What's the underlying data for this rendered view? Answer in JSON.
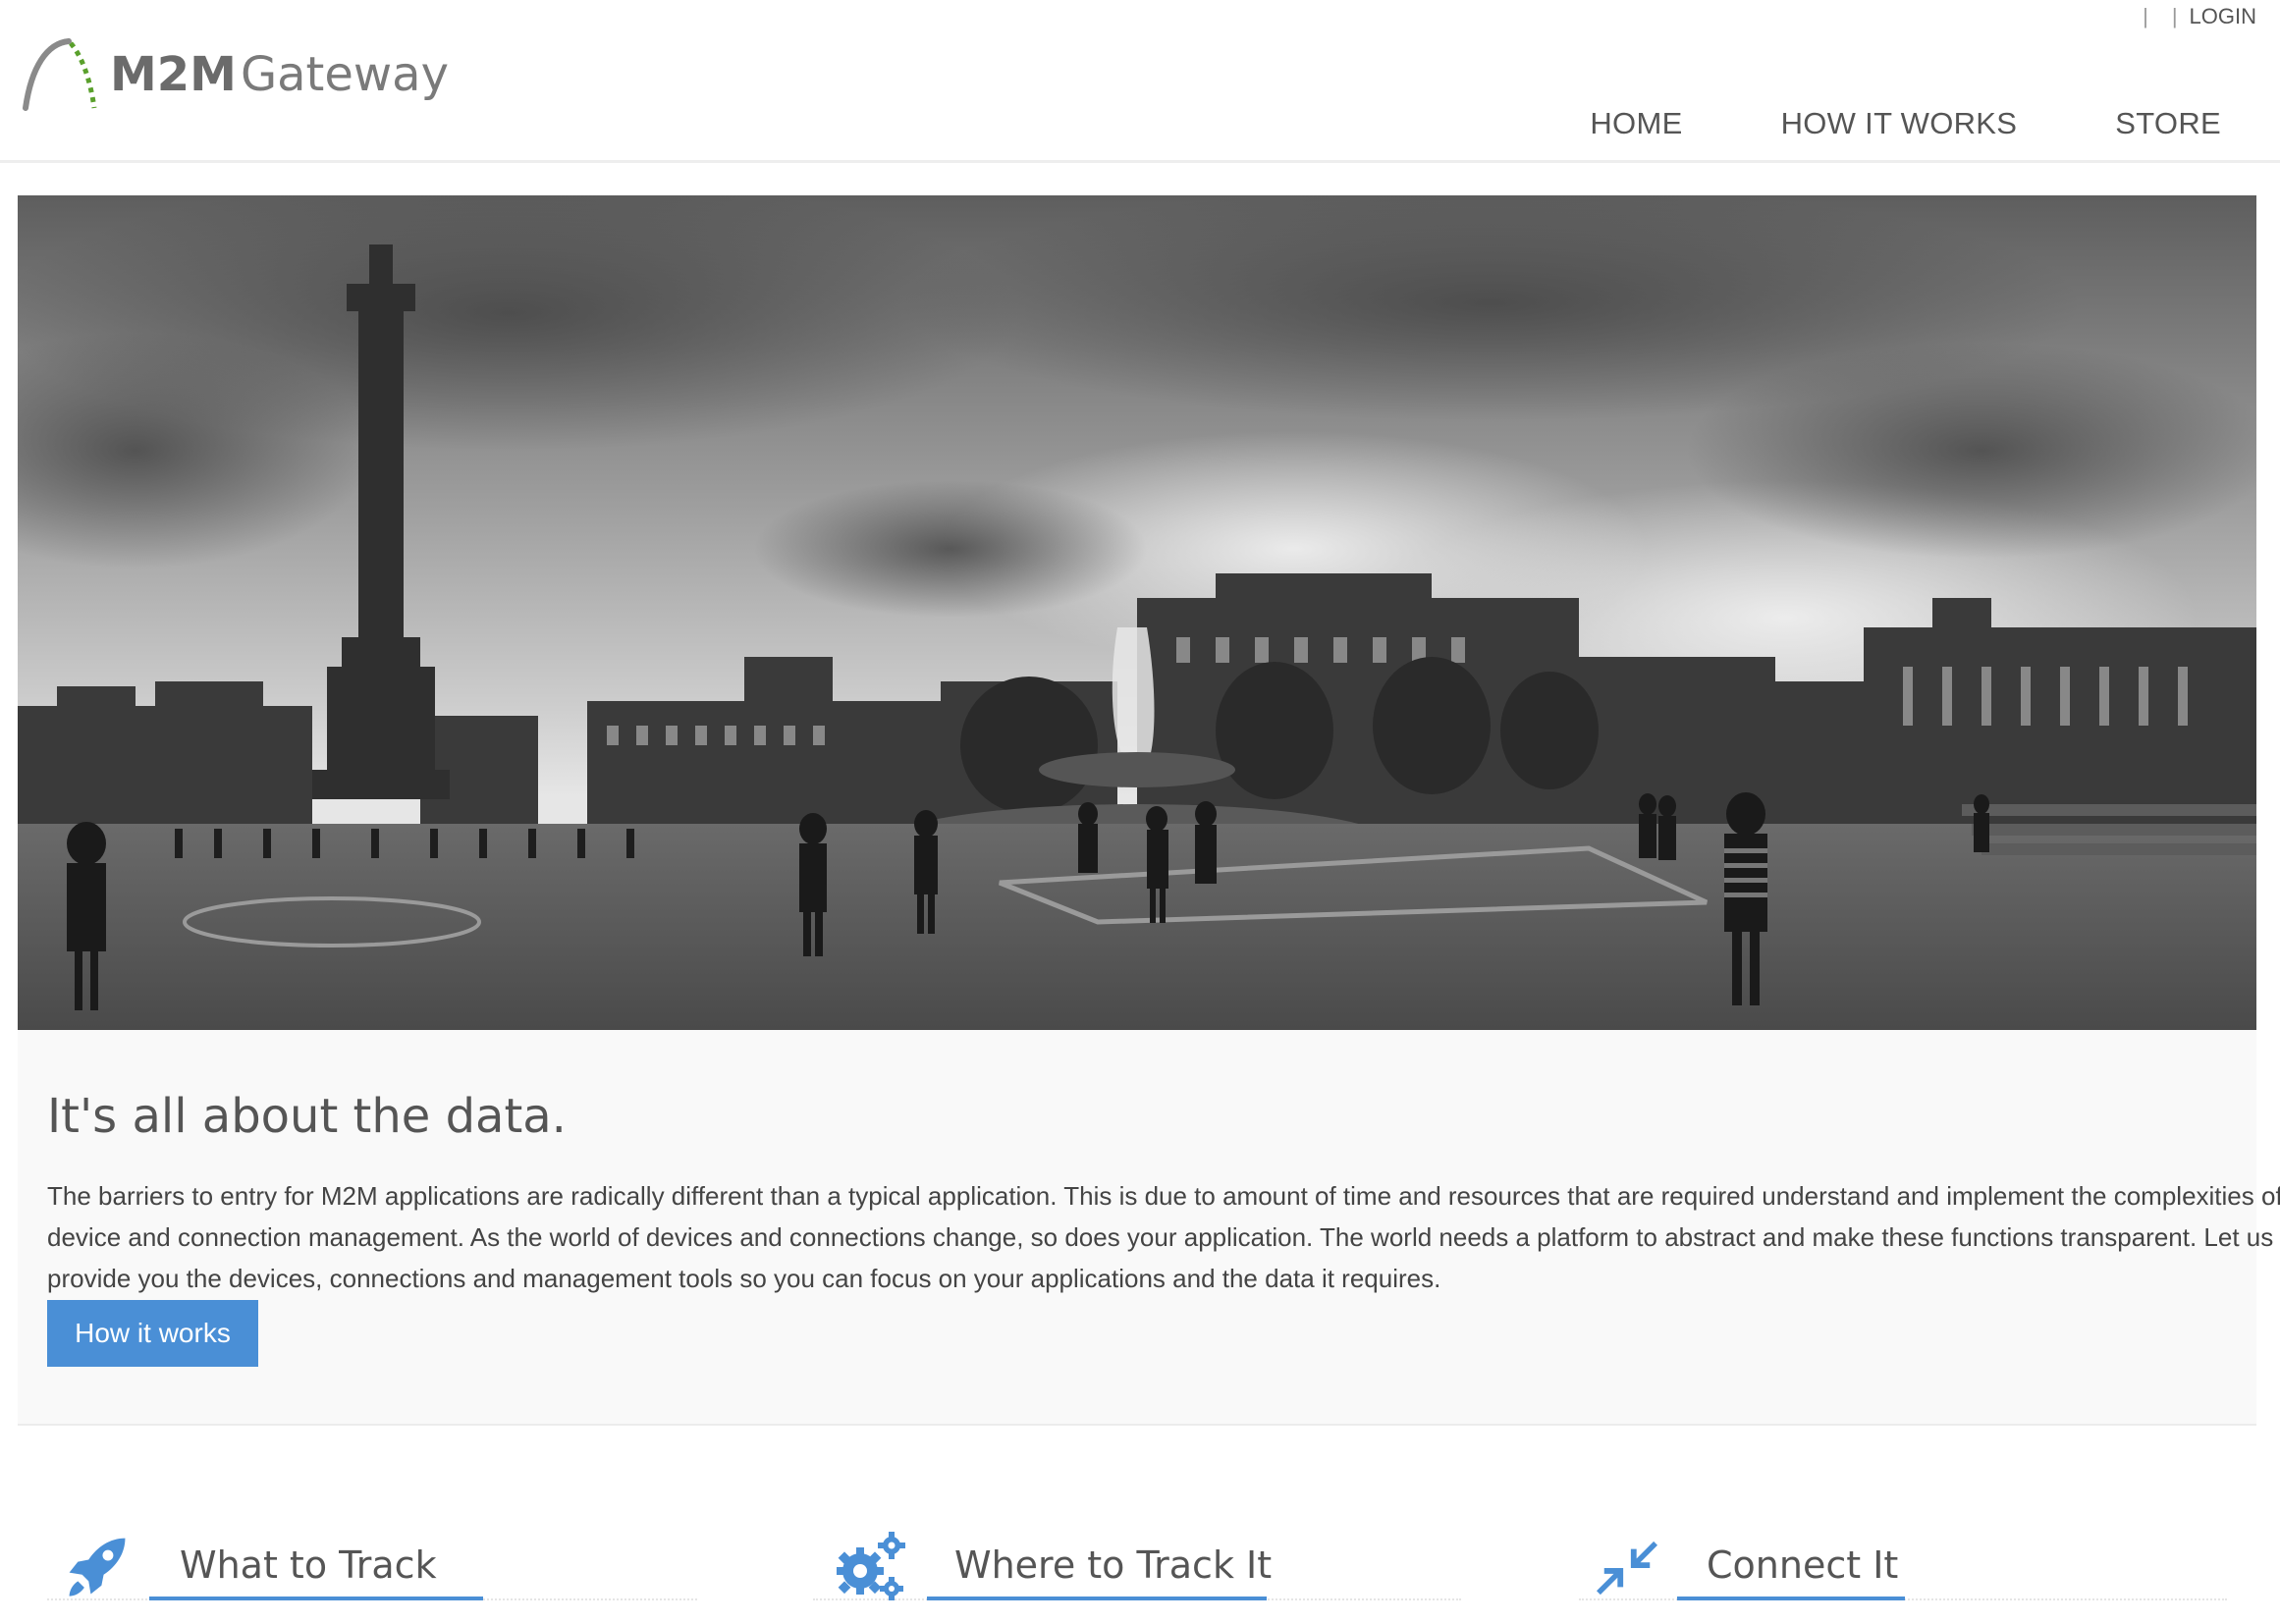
{
  "brand": {
    "m2m": "M2M",
    "gateway": "Gateway"
  },
  "utility": {
    "sep1": "|",
    "sep2": "|",
    "login": "LOGIN"
  },
  "nav": {
    "home": "HOME",
    "how_it_works": "HOW IT WORKS",
    "store": "STORE"
  },
  "hero": {
    "image": "black-and-white panoramic photo of a city square with a column, fountain and buildings"
  },
  "intro": {
    "heading": "It's all about the data.",
    "body": "The barriers to entry for M2M applications are radically different than a typical application. This is due to amount of time and resources that are required understand and implement the complexities of device and connection management. As the world of devices and connections change, so does your application. The world needs a platform to abstract and make these functions transparent. Let us provide you the devices, connections and management tools so you can focus on your applications and the data it requires.",
    "button": "How it works"
  },
  "features": [
    {
      "label": "What to Track",
      "icon": "rocket-icon"
    },
    {
      "label": "Where to Track It",
      "icon": "gears-icon"
    },
    {
      "label": "Connect It",
      "icon": "compress-arrows-icon"
    }
  ],
  "colors": {
    "accent": "#4a8fd6",
    "logo_green": "#5aa02c",
    "text": "#444444"
  }
}
